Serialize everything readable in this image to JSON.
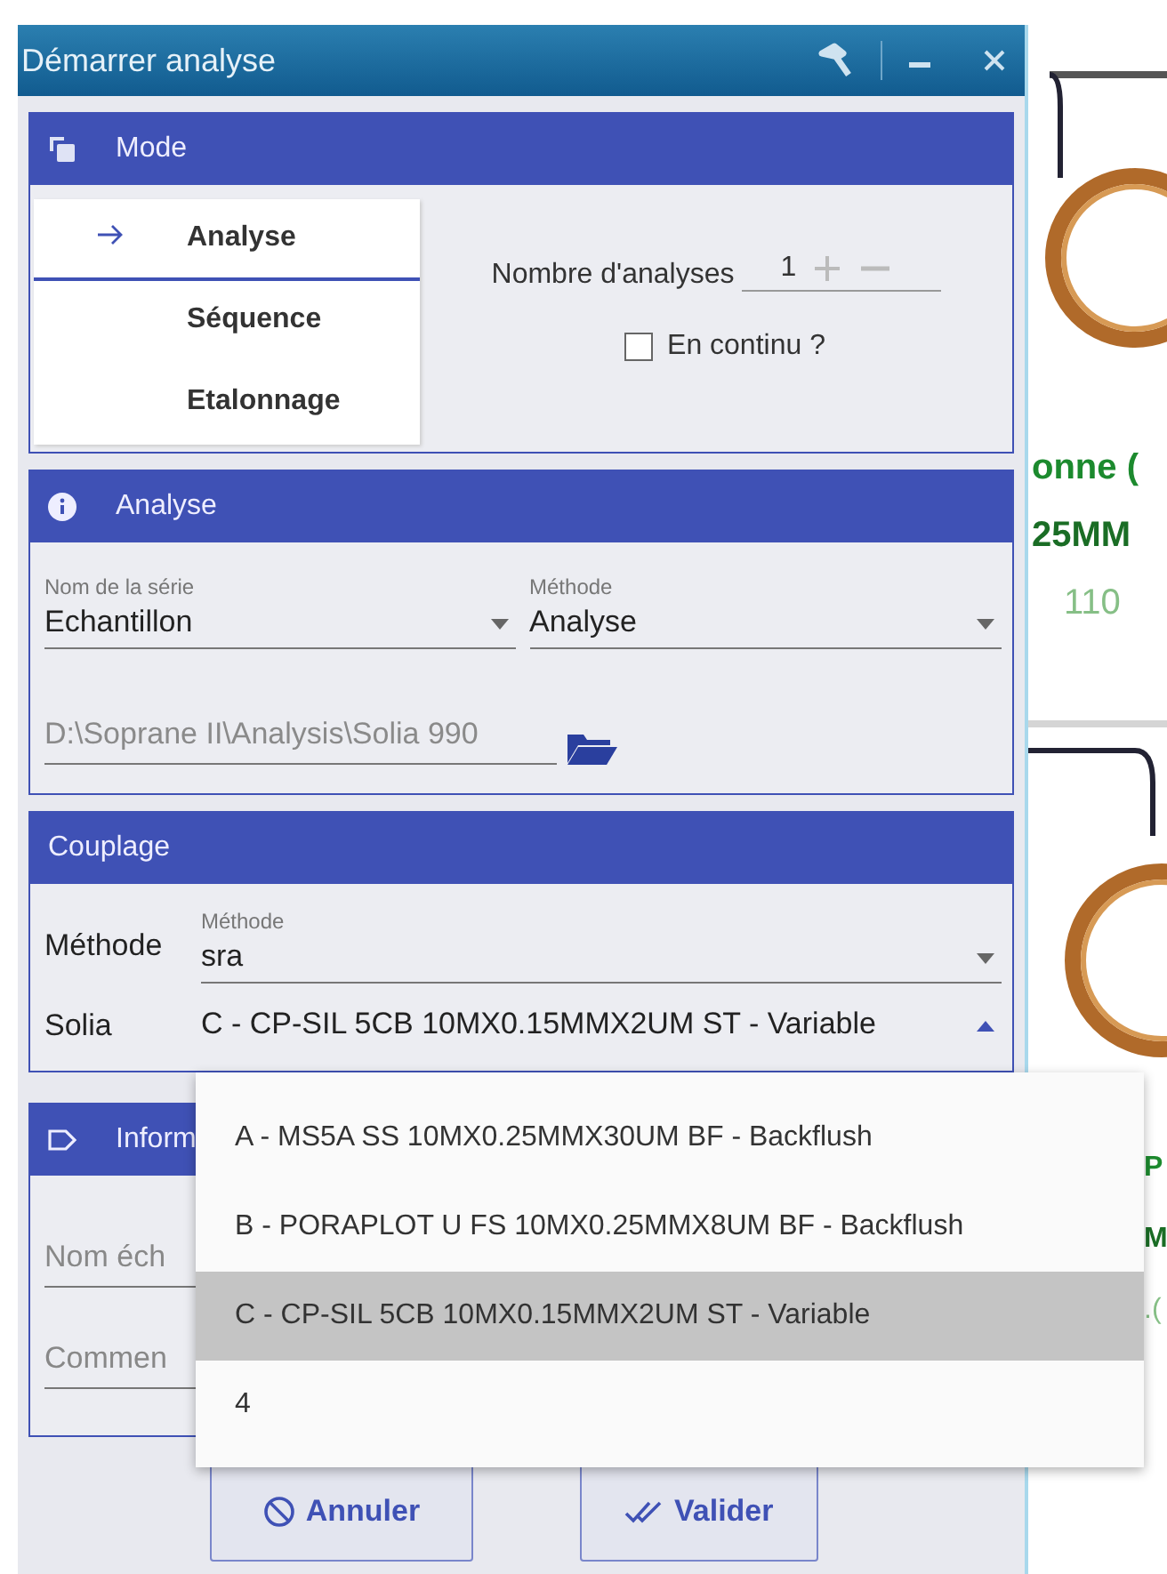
{
  "window": {
    "title": "Démarrer analyse"
  },
  "mode": {
    "title": "Mode",
    "options": [
      {
        "label": "Analyse",
        "selected": true
      },
      {
        "label": "Séquence",
        "selected": false
      },
      {
        "label": "Etalonnage",
        "selected": false
      }
    ],
    "count_label": "Nombre d'analyses",
    "count_value": "1",
    "continuous": {
      "label": "En continu ?",
      "checked": false
    }
  },
  "analyse": {
    "title": "Analyse",
    "series": {
      "label": "Nom de la série",
      "value": "Echantillon"
    },
    "method": {
      "label": "Méthode",
      "value": "Analyse"
    },
    "path": "D:\\Soprane II\\Analysis\\Solia 990"
  },
  "couplage": {
    "title": "Couplage",
    "method_label": "Méthode",
    "method": {
      "label": "Méthode",
      "value": "sra"
    },
    "solia_label": "Solia",
    "solia": {
      "value": "C - CP-SIL 5CB 10MX0.15MMX2UM ST - Variable",
      "expanded": true
    }
  },
  "information": {
    "title": "Inform",
    "fields": [
      {
        "placeholder": "Nom éch"
      },
      {
        "placeholder": "Commen"
      }
    ]
  },
  "dropdown": {
    "options": [
      {
        "label": "A - MS5A SS 10MX0.25MMX30UM BF - Backflush",
        "selected": false
      },
      {
        "label": "B - PORAPLOT U FS 10MX0.25MMX8UM BF - Backflush",
        "selected": false
      },
      {
        "label": "C - CP-SIL 5CB 10MX0.15MMX2UM ST - Variable",
        "selected": true
      },
      {
        "label": "4",
        "selected": false
      }
    ]
  },
  "buttons": [
    {
      "kind": "cancel",
      "label": "Annuler"
    },
    {
      "kind": "confirm",
      "label": "Valider"
    }
  ],
  "background": {
    "texts": [
      {
        "kind": "name",
        "text": "onne ("
      },
      {
        "kind": "ref",
        "text": "25MM"
      },
      {
        "kind": "num",
        "text": "110"
      },
      {
        "kind": "name",
        "text": "P"
      },
      {
        "kind": "ref",
        "text": "M"
      },
      {
        "kind": "num",
        "text": ".("
      }
    ]
  }
}
